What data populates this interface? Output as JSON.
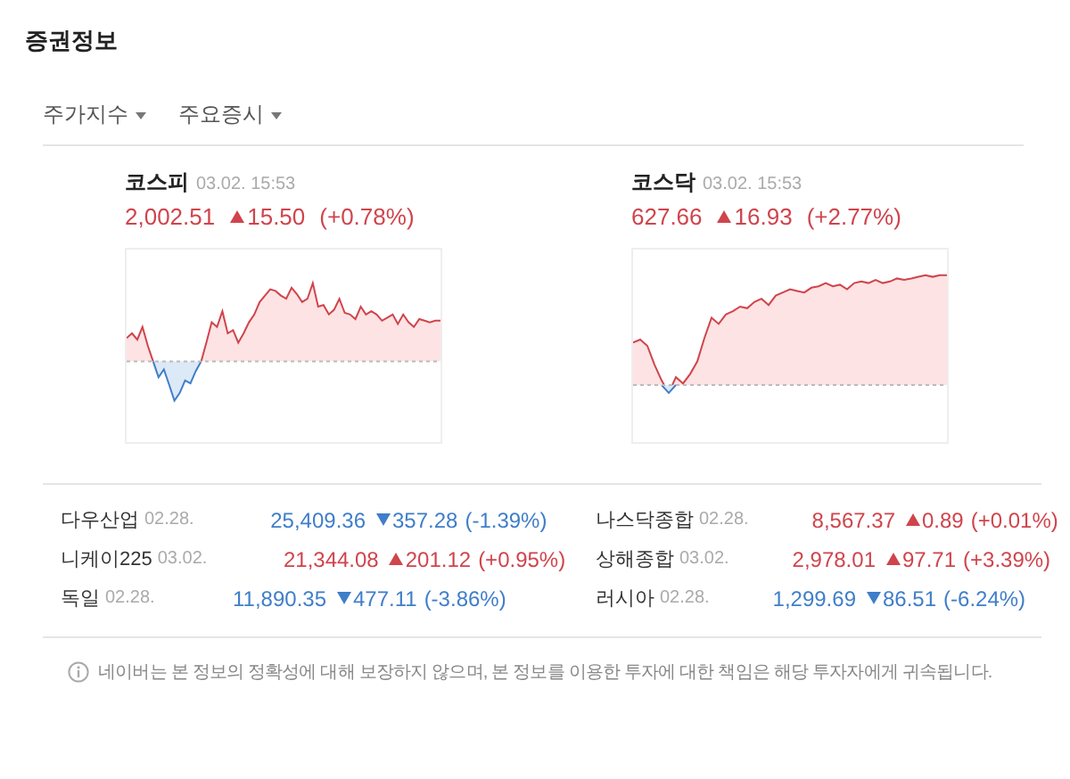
{
  "title": "증권정보",
  "tabs": [
    {
      "label": "주가지수"
    },
    {
      "label": "주요증시"
    }
  ],
  "indices": [
    {
      "name": "코스피",
      "time": "03.02. 15:53",
      "value": "2,002.51",
      "change": "15.50",
      "percent": "(+0.78%)",
      "rising": true
    },
    {
      "name": "코스닥",
      "time": "03.02. 15:53",
      "value": "627.66",
      "change": "16.93",
      "percent": "(+2.77%)",
      "rising": true
    }
  ],
  "markets": [
    {
      "name": "다우산업",
      "date": "02.28.",
      "value": "25,409.36",
      "change": "357.28",
      "percent": "(-1.39%)",
      "rising": false
    },
    {
      "name": "나스닥종합",
      "date": "02.28.",
      "value": "8,567.37",
      "change": "0.89",
      "percent": "(+0.01%)",
      "rising": true
    },
    {
      "name": "니케이225",
      "date": "03.02.",
      "value": "21,344.08",
      "change": "201.12",
      "percent": "(+0.95%)",
      "rising": true
    },
    {
      "name": "상해종합",
      "date": "03.02.",
      "value": "2,978.01",
      "change": "97.71",
      "percent": "(+3.39%)",
      "rising": true
    },
    {
      "name": "독일",
      "date": "02.28.",
      "value": "11,890.35",
      "change": "477.11",
      "percent": "(-3.86%)",
      "rising": false
    },
    {
      "name": "러시아",
      "date": "02.28.",
      "value": "1,299.69",
      "change": "86.51",
      "percent": "(-6.24%)",
      "rising": false
    }
  ],
  "notice": "네이버는 본 정보의 정확성에 대해 보장하지 않으며, 본 정보를 이용한 투자에 대한 책임은 해당 투자자에게 귀속됩니다."
}
